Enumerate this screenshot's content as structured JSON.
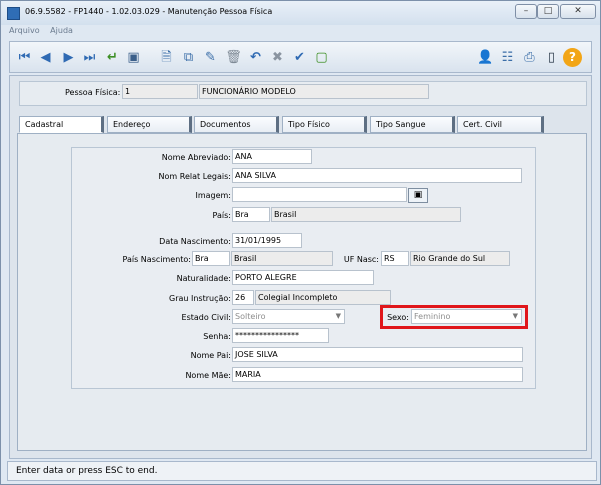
{
  "window": {
    "title": "06.9.5582 - FP1440 - 1.02.03.029 - Manutenção Pessoa Física",
    "min_glyph": "–",
    "max_glyph": "□",
    "close_glyph": "✕"
  },
  "menu": {
    "items": [
      "Arquivo",
      "Ajuda"
    ]
  },
  "toolbar": {
    "icons": {
      "first": "⏮",
      "prev": "◀",
      "next": "▶",
      "last": "⏭",
      "confirm": "↵",
      "view": "▣",
      "new": "🗎",
      "copy": "⧉",
      "edit": "✎",
      "delete": "🗑",
      "undo": "↶",
      "cancel": "✖",
      "check": "✔",
      "document": "▢",
      "user": "👤",
      "tree": "☷",
      "print": "⎙",
      "exit": "▯",
      "help": "?"
    }
  },
  "person": {
    "label": "Pessoa Física:",
    "id": "1",
    "name": "FUNCIONÁRIO MODELO"
  },
  "tabs": [
    "Cadastral",
    "Endereço",
    "Documentos",
    "Tipo Físico",
    "Tipo Sangue",
    "Cert. Civil"
  ],
  "form": {
    "nome_abreviado": {
      "label": "Nome Abreviado:",
      "value": "ANA"
    },
    "nom_relat": {
      "label": "Nom Relat Legais:",
      "value": "ANA SILVA"
    },
    "imagem": {
      "label": "Imagem:",
      "value": ""
    },
    "pais": {
      "label": "País:",
      "code": "Bra",
      "name": "Brasil"
    },
    "data_nascimento": {
      "label": "Data Nascimento:",
      "value": "31/01/1995"
    },
    "pais_nascimento": {
      "label": "País Nascimento:",
      "code": "Bra",
      "name": "Brasil"
    },
    "uf_nasc": {
      "label": "UF Nasc:",
      "code": "RS",
      "name": "Rio Grande do Sul"
    },
    "naturalidade": {
      "label": "Naturalidade:",
      "value": "PORTO ALEGRE"
    },
    "grau_instrucao": {
      "label": "Grau Instrução:",
      "code": "26",
      "name": "Colegial Incompleto"
    },
    "estado_civil": {
      "label": "Estado Civil:",
      "value": "Solteiro"
    },
    "sexo": {
      "label": "Sexo:",
      "value": "Feminino"
    },
    "senha": {
      "label": "Senha:",
      "value": "****************"
    },
    "nome_pai": {
      "label": "Nome Pai:",
      "value": "JOSE SILVA"
    },
    "nome_mae": {
      "label": "Nome Mãe:",
      "value": "MARIA"
    }
  },
  "status": {
    "text": "Enter data or press ESC to end."
  }
}
